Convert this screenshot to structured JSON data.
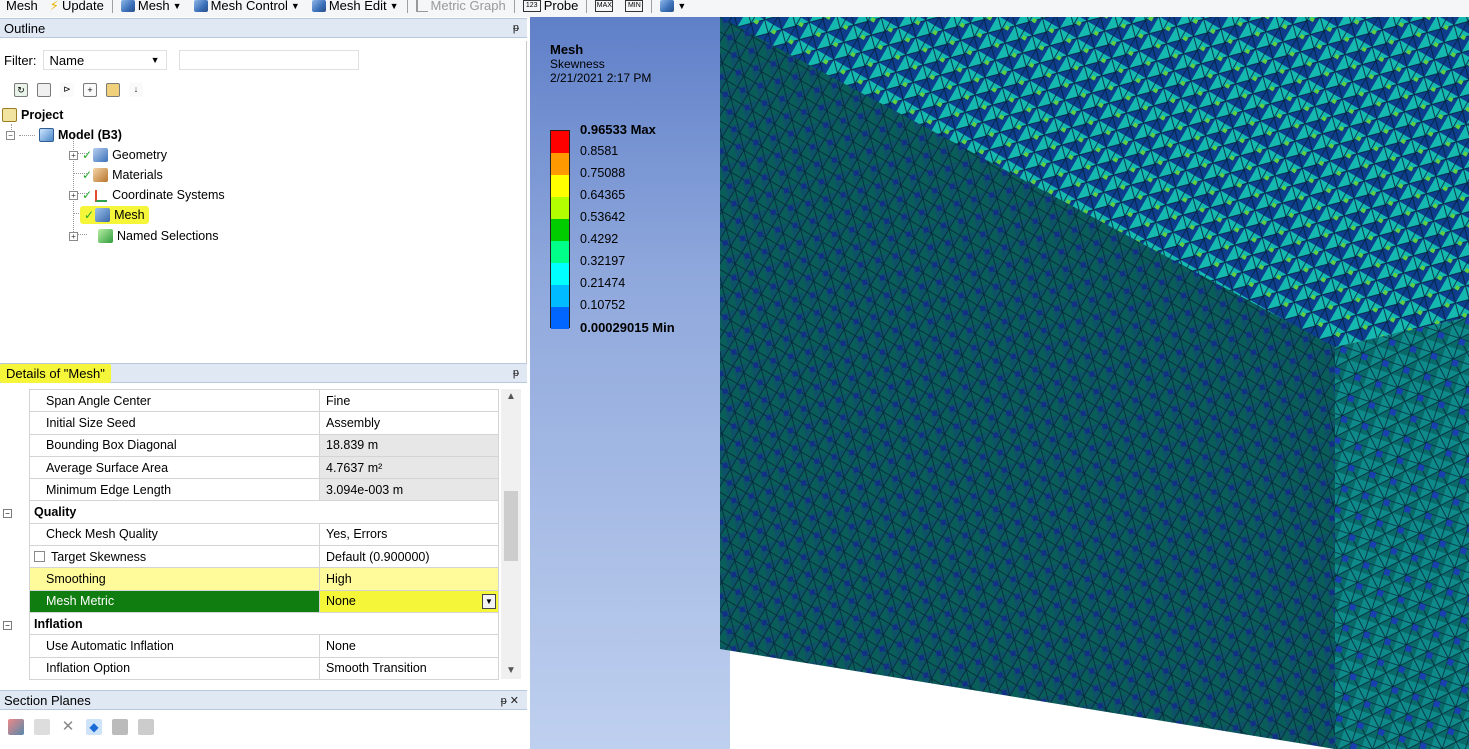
{
  "toolbar": {
    "mesh": "Mesh",
    "update": "Update",
    "mesh_menu": "Mesh",
    "mesh_control": "Mesh Control",
    "mesh_edit": "Mesh Edit",
    "metric_graph": "Metric Graph",
    "probe": "Probe",
    "max_icon_label": "MAX",
    "min_icon_label": "MIN"
  },
  "outline": {
    "title": "Outline",
    "filter_label": "Filter:",
    "filter_value": "Name",
    "tree": {
      "project": "Project",
      "model": "Model (B3)",
      "geometry": "Geometry",
      "materials": "Materials",
      "coordinate_systems": "Coordinate Systems",
      "mesh": "Mesh",
      "named_selections": "Named Selections"
    }
  },
  "details": {
    "title": "Details of \"Mesh\"",
    "rows": [
      {
        "label": "Span Angle Center",
        "value": "Fine"
      },
      {
        "label": "Initial Size Seed",
        "value": "Assembly"
      },
      {
        "label": "Bounding Box Diagonal",
        "value": "18.839 m"
      },
      {
        "label": "Average Surface Area",
        "value": "4.7637 m²"
      },
      {
        "label": "Minimum Edge Length",
        "value": "3.094e-003 m"
      },
      {
        "label": "Quality",
        "value": ""
      },
      {
        "label": "Check Mesh Quality",
        "value": "Yes, Errors"
      },
      {
        "label": "Target Skewness",
        "value": "Default (0.900000)"
      },
      {
        "label": "Smoothing",
        "value": "High"
      },
      {
        "label": "Mesh Metric",
        "value": "None"
      },
      {
        "label": "Inflation",
        "value": ""
      },
      {
        "label": "Use Automatic Inflation",
        "value": "None"
      },
      {
        "label": "Inflation Option",
        "value": "Smooth Transition"
      }
    ]
  },
  "section_planes": {
    "title": "Section Planes"
  },
  "viewport": {
    "legend_title": "Mesh",
    "legend_subtitle": "Skewness",
    "legend_date": "2/21/2021 2:17 PM",
    "legend_labels": [
      "0.96533 Max",
      "0.8581",
      "0.75088",
      "0.64365",
      "0.53642",
      "0.4292",
      "0.32197",
      "0.21474",
      "0.10752",
      "0.00029015 Min"
    ],
    "legend_colors": [
      "#ff0000",
      "#ff9900",
      "#ffff00",
      "#b3ff00",
      "#00cc00",
      "#00ff88",
      "#00ffff",
      "#00bbff",
      "#0066ff",
      "#0000ff"
    ]
  }
}
